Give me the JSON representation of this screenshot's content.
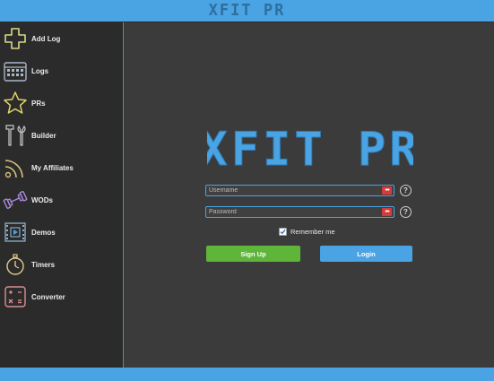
{
  "app": {
    "title": "XFIT PR"
  },
  "colors": {
    "accent": "#4aa3e3",
    "signup": "#5fb43a",
    "sidebar_bg": "#2b2b2b",
    "main_bg": "#3b3b3b",
    "key_icon": "#d83a3a"
  },
  "sidebar": {
    "items": [
      {
        "label": "Add Log",
        "icon": "plus-icon"
      },
      {
        "label": "Logs",
        "icon": "calendar-icon"
      },
      {
        "label": "PRs",
        "icon": "star-icon"
      },
      {
        "label": "Builder",
        "icon": "tools-icon"
      },
      {
        "label": "My Affiliates",
        "icon": "rss-icon"
      },
      {
        "label": "WODs",
        "icon": "dumbbell-icon"
      },
      {
        "label": "Demos",
        "icon": "film-icon"
      },
      {
        "label": "Timers",
        "icon": "stopwatch-icon"
      },
      {
        "label": "Converter",
        "icon": "calculator-icon"
      }
    ]
  },
  "login": {
    "logo_text": "XFIT PR",
    "username_placeholder": "Username",
    "password_placeholder": "Password",
    "help_label": "?",
    "remember_label": "Remember me",
    "remember_checked": true,
    "signup_label": "Sign Up",
    "login_label": "Login"
  }
}
